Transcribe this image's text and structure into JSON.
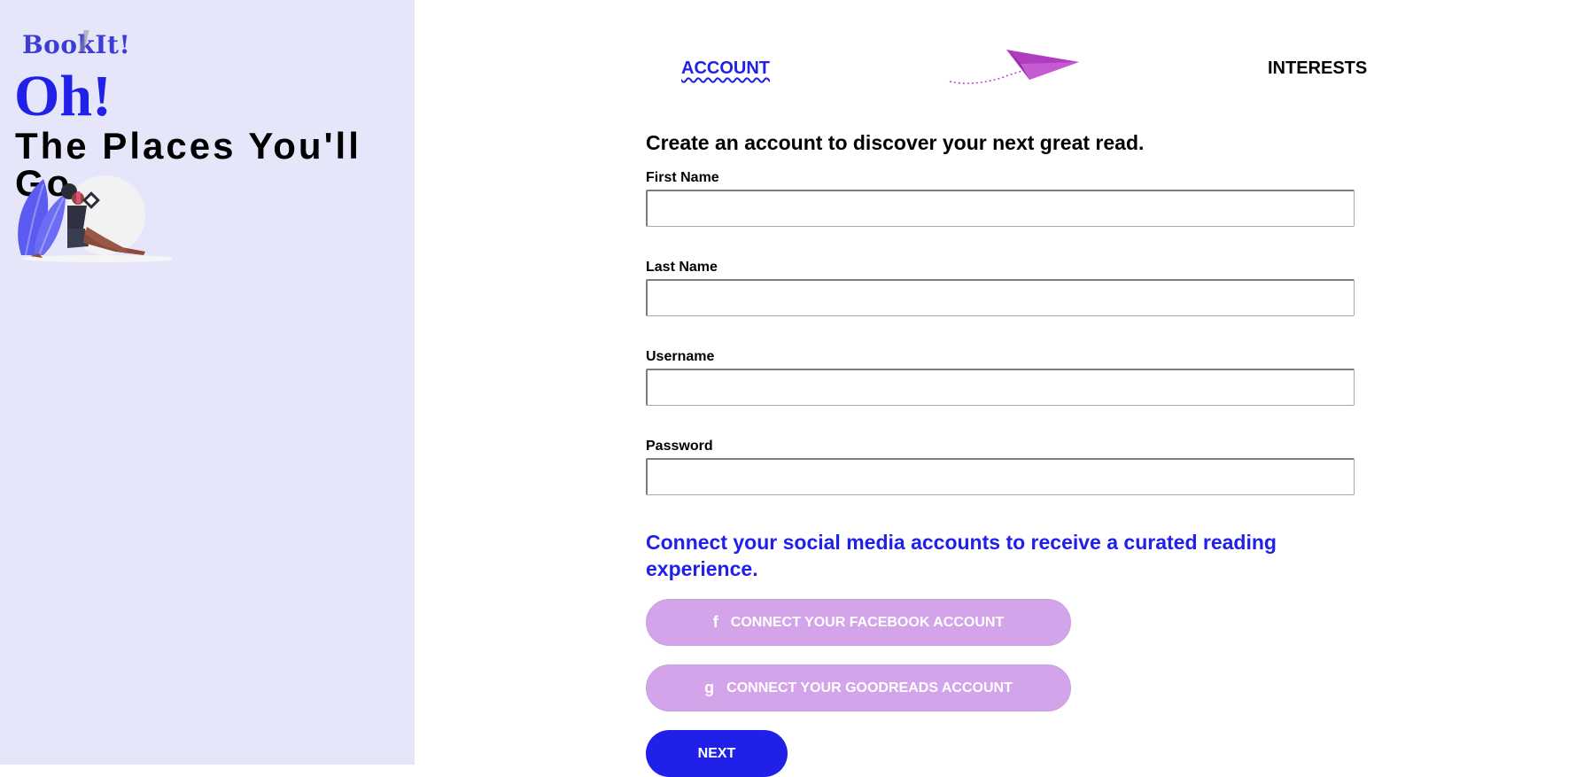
{
  "brand": {
    "logo": "BookIt!",
    "headline": "Oh!",
    "subheadline": "The Places You'll Go"
  },
  "steps": {
    "account": "ACCOUNT",
    "interests": "INTERESTS",
    "current": "ACCOUNT"
  },
  "form": {
    "intro": "Create an account to discover your next great read.",
    "fields": [
      {
        "label": "First Name",
        "value": ""
      },
      {
        "label": "Last Name",
        "value": ""
      },
      {
        "label": "Username",
        "value": ""
      },
      {
        "label": "Password",
        "value": ""
      }
    ],
    "connect_heading": "Connect your social media accounts to receive a curated reading experience.",
    "facebook_button": "CONNECT YOUR FACEBOOK ACCOUNT",
    "facebook_icon": "f",
    "goodreads_button": "CONNECT YOUR GOODREADS ACCOUNT",
    "goodreads_icon": "g",
    "next_button": "NEXT"
  },
  "colors": {
    "sidebar_bg": "#e6e6fa",
    "accent": "#2020e8",
    "social_button": "#d3a4ea",
    "plane": "#b03cc0"
  }
}
